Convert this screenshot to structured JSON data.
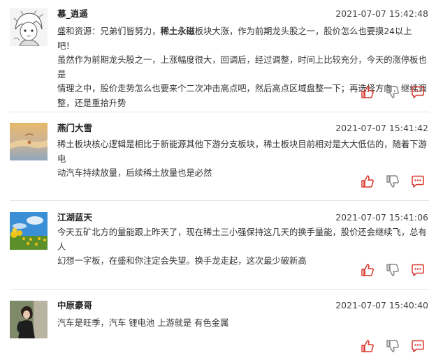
{
  "comments": [
    {
      "username": "慕_逍遥",
      "time": "2021-07-07 15:42:48",
      "lines": [
        {
          "src": "盛和资源",
          "pre": "：兄弟们皆努力，",
          "kw": "稀土永磁",
          "post": "板块大涨，作为前期龙头股之一，股价怎么也要摸24以上吧！"
        },
        {
          "text": "虽然作为前期龙头股之一，上涨幅度很大，回调后，经过调整，时间上比较充分，今天的涨停板也是"
        },
        {
          "text": "情理之中，股价走势怎么也要来个二次冲击高点吧，然后高点区域盘整一下；再选择方向：继续调"
        },
        {
          "text": "整，还是重拾升势"
        }
      ]
    },
    {
      "username": "燕门大雪",
      "time": "2021-07-07 15:41:42",
      "lines": [
        {
          "text": "稀土板块核心逻辑是相比于新能源其他下游分支板块，稀土板块目前相对是大大低估的，随着下游电"
        },
        {
          "text": "动汽车持续放量，后续稀土放量也是必然"
        }
      ]
    },
    {
      "username": "江湖蓝天",
      "time": "2021-07-07 15:41:06",
      "lines": [
        {
          "text": "今天五矿北方的量能跟上昨天了，现在稀土三小强保持这几天的换手量能，股价还会继续飞，总有人"
        },
        {
          "text": "幻想一字板，在盛和你注定会失望。换手龙走起，这次最少破新高"
        }
      ]
    },
    {
      "username": "中原豪哥",
      "time": "2021-07-07 15:40:40",
      "lines": [
        {
          "text": "汽车是旺季，汽车 锂电池 上游就是 有色金属"
        }
      ]
    }
  ],
  "icons": {
    "like": "thumbs-up-icon",
    "dislike": "thumbs-down-icon",
    "reply": "comment-icon"
  },
  "colors": {
    "accent": "#d9362b",
    "divider": "#e4e4e4"
  }
}
